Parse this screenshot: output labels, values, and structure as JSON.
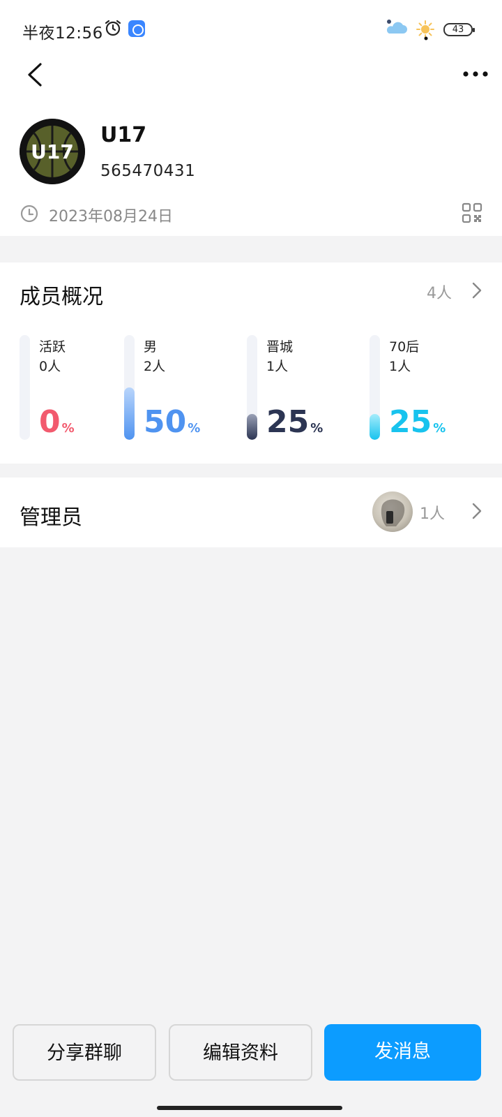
{
  "status_bar": {
    "time": "半夜12:56",
    "battery": "43",
    "icons": [
      "alarm-icon",
      "app-notification-icon",
      "weather-cloudy-icon",
      "weather-sunny-icon"
    ]
  },
  "header": {
    "back_icon": "chevron-left-icon",
    "more_icon": "more-horizontal-icon"
  },
  "group": {
    "avatar_text": "U17",
    "name": "U17",
    "id": "565470431",
    "created_date": "2023年08月24日"
  },
  "members": {
    "title": "成员概况",
    "count": "4人",
    "stats": [
      {
        "label": "活跃",
        "count": "0人",
        "percent": "0",
        "fraction": 0.0,
        "color": "#f25a6e"
      },
      {
        "label": "男",
        "count": "2人",
        "percent": "50",
        "fraction": 0.5,
        "color": "#4f93f0"
      },
      {
        "label": "晋城",
        "count": "1人",
        "percent": "25",
        "fraction": 0.25,
        "color": "#2c3553"
      },
      {
        "label": "70后",
        "count": "1人",
        "percent": "25",
        "fraction": 0.25,
        "color": "#18c3ee"
      }
    ],
    "percent_sign": "%"
  },
  "admins": {
    "title": "管理员",
    "count": "1人"
  },
  "actions": {
    "share": "分享群聊",
    "edit": "编辑资料",
    "message": "发消息"
  },
  "colors": {
    "primary": "#0c9cff",
    "background": "#f3f3f4"
  }
}
